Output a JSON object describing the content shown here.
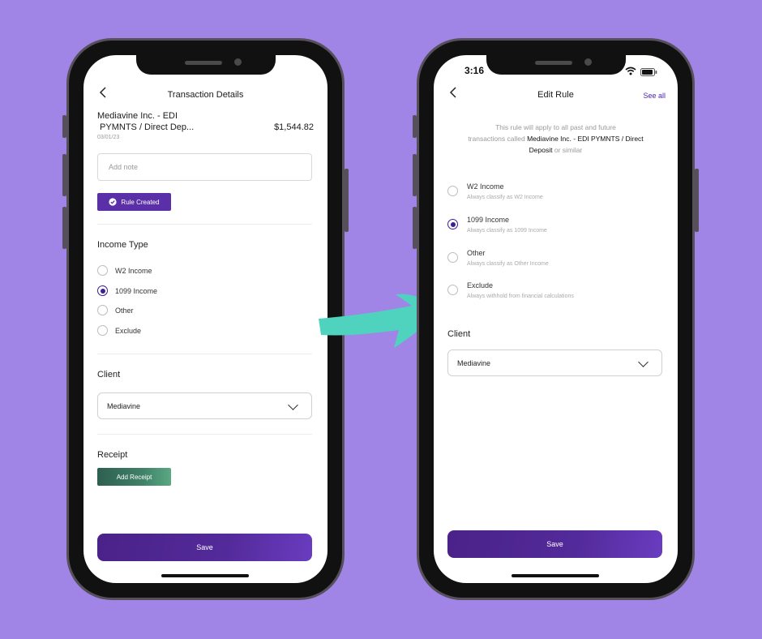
{
  "left": {
    "title": "Transaction Details",
    "merchant_line1": "Mediavine Inc. - EDI",
    "merchant_line2": " PYMNTS / Direct Dep...",
    "amount": "$1,544.82",
    "date": "03/01/23",
    "note_placeholder": "Add note",
    "rule_badge": "Rule Created",
    "income_type_heading": "Income Type",
    "options": [
      {
        "label": "W2 Income",
        "selected": false
      },
      {
        "label": "1099 Income",
        "selected": true
      },
      {
        "label": "Other",
        "selected": false
      },
      {
        "label": "Exclude",
        "selected": false
      }
    ],
    "client_heading": "Client",
    "client_value": "Mediavine",
    "receipt_heading": "Receipt",
    "add_receipt": "Add Receipt",
    "save": "Save"
  },
  "right": {
    "status_time": "3:16",
    "title": "Edit Rule",
    "see_all": "See all",
    "desc_line1": "This rule will apply to all past and future",
    "desc_prefix": "transactions called ",
    "desc_bold1": "Mediavine Inc. - EDI PYMNTS / Direct",
    "desc_bold2": "Deposit",
    "desc_suffix": " or similar",
    "options": [
      {
        "label": "W2 Income",
        "sub": "Always classify as W2 Income",
        "selected": false
      },
      {
        "label": "1099 Income",
        "sub": "Always classify as 1099 Income",
        "selected": true
      },
      {
        "label": "Other",
        "sub": "Always classify as Other Income",
        "selected": false
      },
      {
        "label": "Exclude",
        "sub": "Always withhold from financial calculations",
        "selected": false
      }
    ],
    "client_heading": "Client",
    "client_value": "Mediavine",
    "save": "Save"
  },
  "colors": {
    "background": "#a084e6",
    "primary_purple": "#4a2288",
    "badge_purple": "#5b2fa8",
    "receipt_green": "#2f6b58",
    "arrow_teal": "#4fd3bf",
    "link_purple": "#4a1fb8"
  },
  "icons": [
    "back-chevron-icon",
    "check-circle-icon",
    "chevron-down-icon",
    "wifi-icon",
    "battery-icon",
    "arrow-icon"
  ]
}
